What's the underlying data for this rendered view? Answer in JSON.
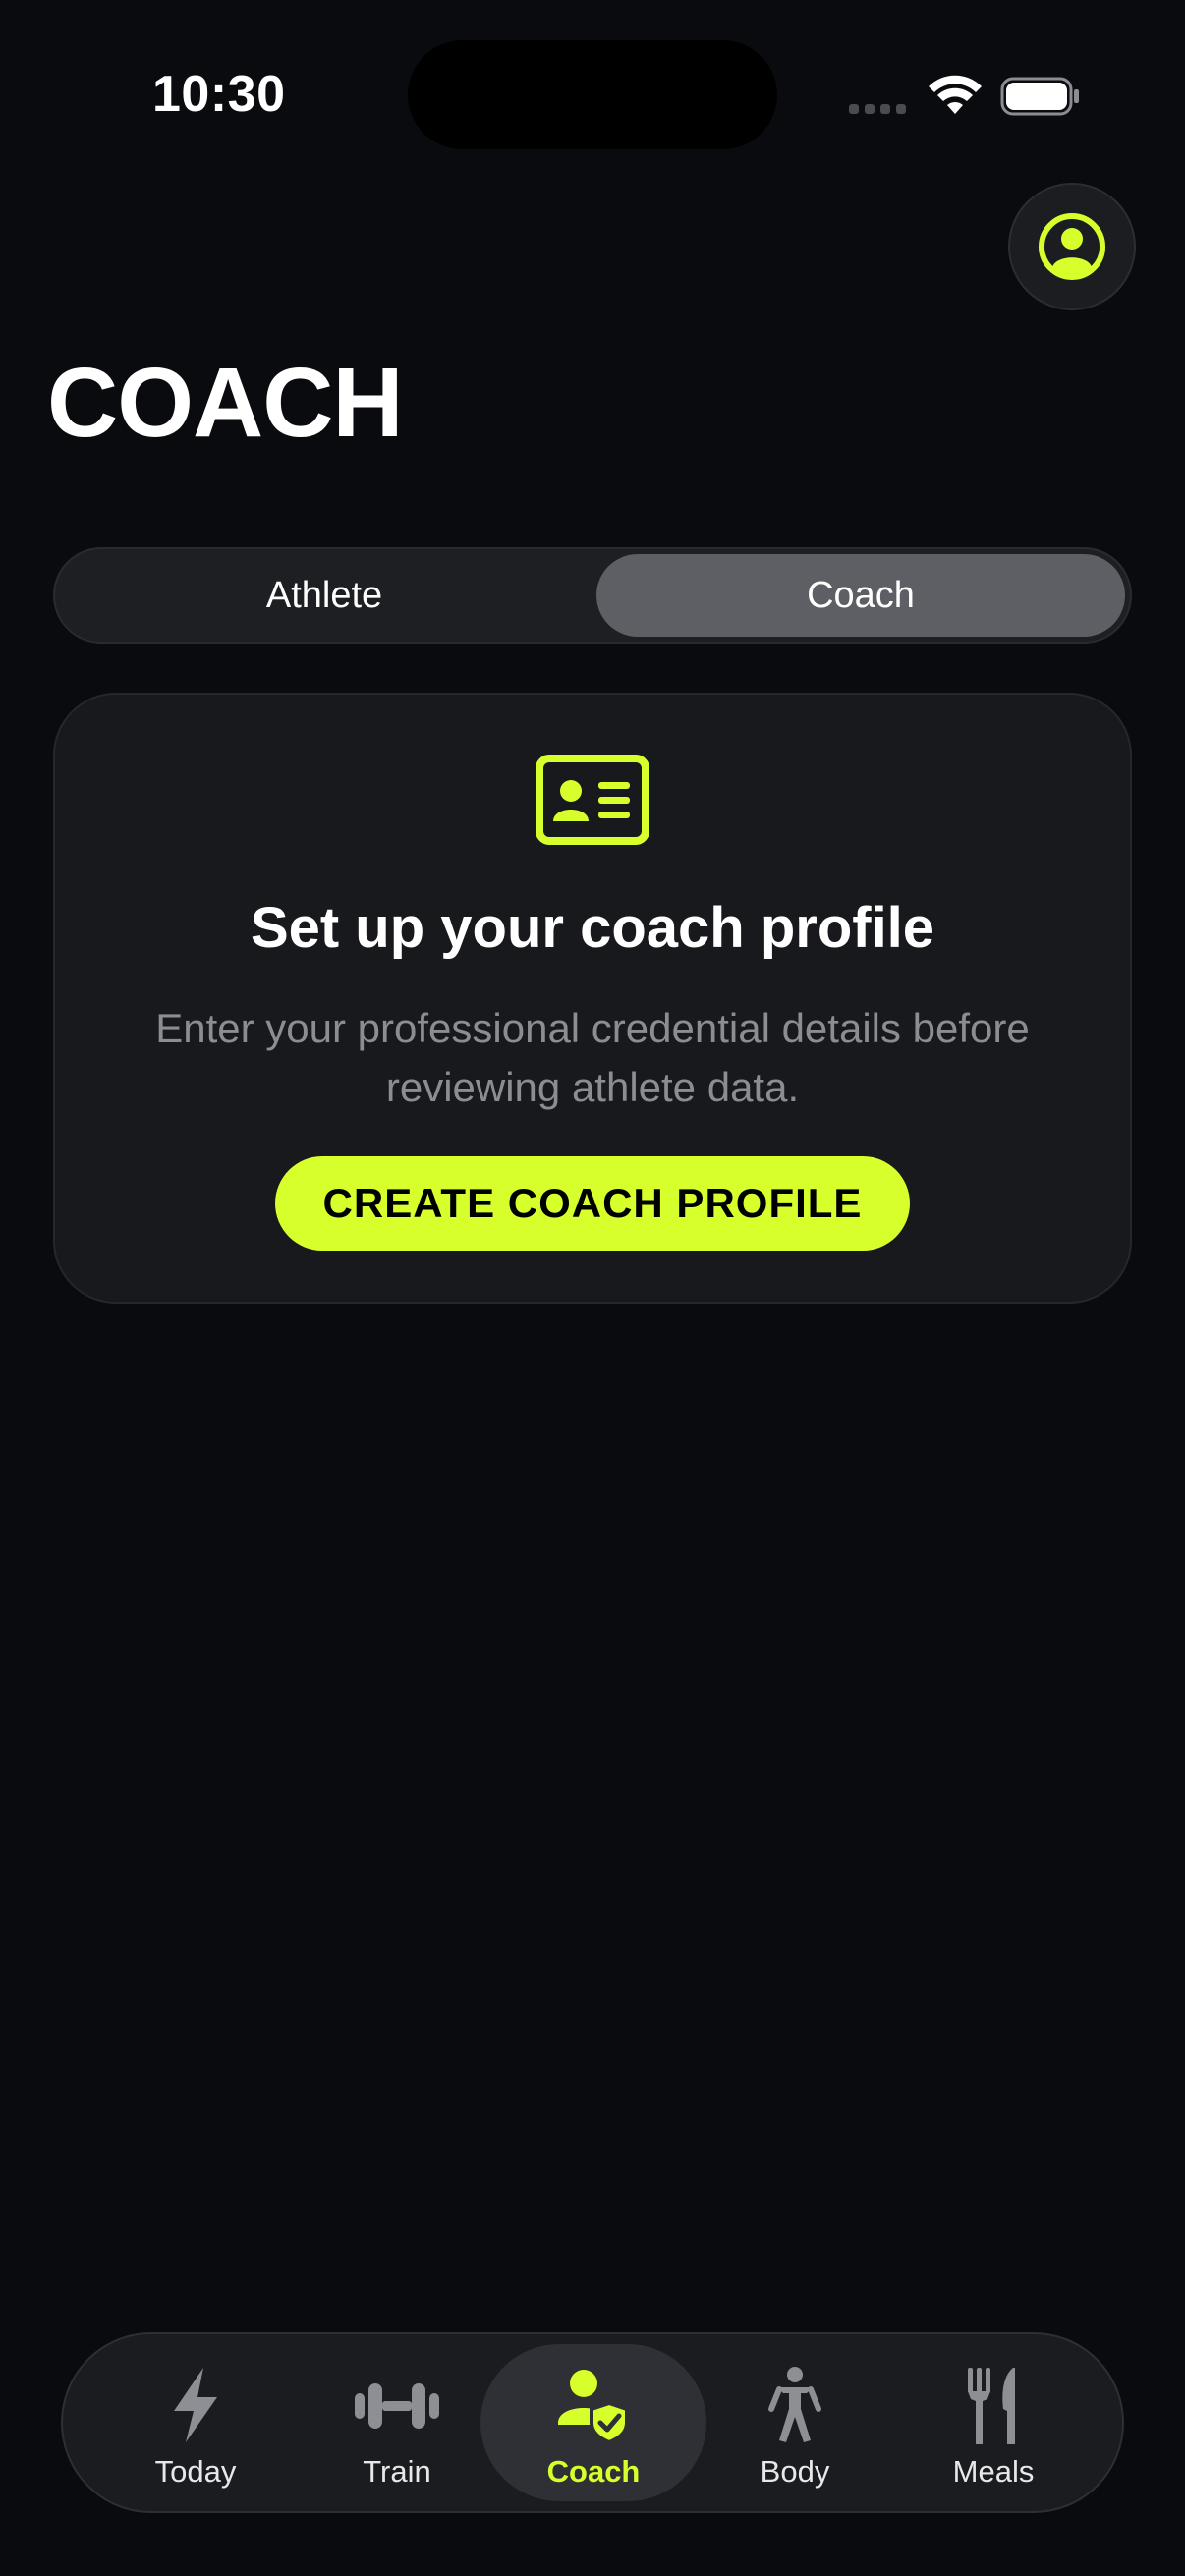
{
  "status_bar": {
    "time": "10:30"
  },
  "header": {
    "title": "COACH"
  },
  "segmented_control": {
    "options": [
      "Athlete",
      "Coach"
    ],
    "selected": "Coach"
  },
  "setup_card": {
    "title": "Set up your coach profile",
    "description": "Enter your professional credential details before reviewing athlete data.",
    "button_label": "CREATE COACH PROFILE"
  },
  "tab_bar": {
    "items": [
      {
        "label": "Today",
        "icon": "bolt-icon"
      },
      {
        "label": "Train",
        "icon": "dumbbell-icon"
      },
      {
        "label": "Coach",
        "icon": "coach-verified-icon"
      },
      {
        "label": "Body",
        "icon": "person-standing-icon"
      },
      {
        "label": "Meals",
        "icon": "fork-knife-icon"
      }
    ],
    "active": "Coach"
  },
  "colors": {
    "background": "#0a0b0e",
    "accent": "#d7ff2b",
    "card": "#18191c",
    "muted_text": "#8c8d92"
  }
}
